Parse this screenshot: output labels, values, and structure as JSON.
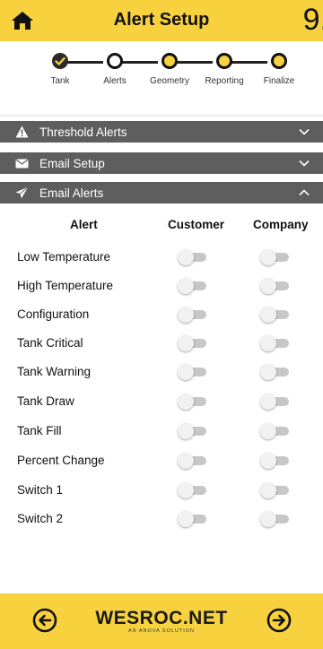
{
  "header": {
    "title": "Alert Setup",
    "step_number": "9.",
    "home_icon": "home-icon"
  },
  "stepper": {
    "steps": [
      {
        "label": "Tank",
        "state": "done"
      },
      {
        "label": "Alerts",
        "state": "current"
      },
      {
        "label": "Geometry",
        "state": "pending"
      },
      {
        "label": "Reporting",
        "state": "pending"
      },
      {
        "label": "Finalize",
        "state": "pending"
      }
    ]
  },
  "sections": [
    {
      "label": "Threshold Alerts",
      "icon": "warning-icon",
      "expanded": false
    },
    {
      "label": "Email Setup",
      "icon": "envelope-icon",
      "expanded": false
    },
    {
      "label": "Email Alerts",
      "icon": "paper-plane-icon",
      "expanded": true
    }
  ],
  "alerts_table": {
    "headers": {
      "alert": "Alert",
      "customer": "Customer",
      "company": "Company"
    },
    "rows": [
      {
        "label": "Low Temperature",
        "customer": false,
        "company": false
      },
      {
        "label": "High Temperature",
        "customer": false,
        "company": false
      },
      {
        "label": "Configuration",
        "customer": false,
        "company": false
      },
      {
        "label": "Tank Critical",
        "customer": false,
        "company": false
      },
      {
        "label": "Tank Warning",
        "customer": false,
        "company": false
      },
      {
        "label": "Tank Draw",
        "customer": false,
        "company": false
      },
      {
        "label": "Tank Fill",
        "customer": false,
        "company": false
      },
      {
        "label": "Percent Change",
        "customer": false,
        "company": false
      },
      {
        "label": "Switch 1",
        "customer": false,
        "company": false
      },
      {
        "label": "Switch 2",
        "customer": false,
        "company": false
      }
    ]
  },
  "footer": {
    "brand": "WESROC.NET",
    "tagline": "AN ANOVA SOLUTION",
    "back_icon": "arrow-left-circle-icon",
    "next_icon": "arrow-right-circle-icon"
  },
  "colors": {
    "accent": "#f7d23e",
    "section_bar": "#5e5e5e",
    "toggle_track_off": "#c7c7c7"
  }
}
